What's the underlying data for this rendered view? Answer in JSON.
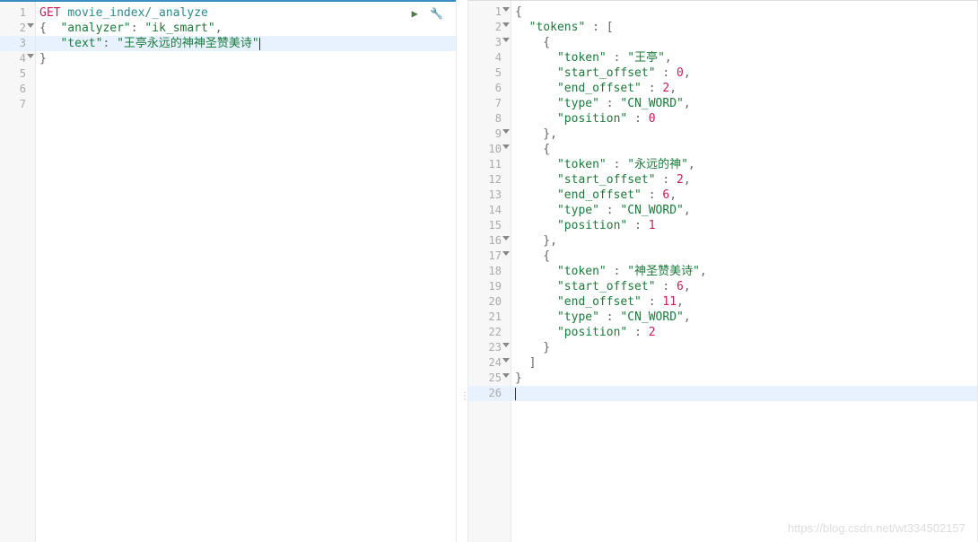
{
  "left": {
    "lines": [
      {
        "n": "1",
        "fold": false,
        "hl": false,
        "segs": [
          {
            "t": "GET ",
            "c": "method"
          },
          {
            "t": "movie_index/_analyze",
            "c": "url"
          }
        ]
      },
      {
        "n": "2",
        "fold": true,
        "hl": false,
        "segs": [
          {
            "t": "{  ",
            "c": "punct"
          },
          {
            "t": "\"analyzer\"",
            "c": "key"
          },
          {
            "t": ": ",
            "c": "punct"
          },
          {
            "t": "\"ik_smart\"",
            "c": "str"
          },
          {
            "t": ",",
            "c": "punct"
          }
        ]
      },
      {
        "n": "3",
        "fold": false,
        "hl": true,
        "segs": [
          {
            "t": "   ",
            "c": ""
          },
          {
            "t": "\"text\"",
            "c": "key"
          },
          {
            "t": ": ",
            "c": "punct"
          },
          {
            "t": "\"王亭永远的神神圣赞美诗\"",
            "c": "str"
          }
        ],
        "cursor": true
      },
      {
        "n": "4",
        "fold": true,
        "hl": false,
        "segs": [
          {
            "t": "}",
            "c": "punct"
          }
        ]
      },
      {
        "n": "5",
        "fold": false,
        "hl": false,
        "segs": []
      },
      {
        "n": "6",
        "fold": false,
        "hl": false,
        "segs": []
      },
      {
        "n": "7",
        "fold": false,
        "hl": false,
        "segs": []
      }
    ]
  },
  "right": {
    "lines": [
      {
        "n": "1",
        "fold": true,
        "hl": false,
        "segs": [
          {
            "t": "{",
            "c": "punct"
          }
        ]
      },
      {
        "n": "2",
        "fold": true,
        "hl": false,
        "segs": [
          {
            "t": "  ",
            "c": ""
          },
          {
            "t": "\"tokens\"",
            "c": "key"
          },
          {
            "t": " : [",
            "c": "punct"
          }
        ]
      },
      {
        "n": "3",
        "fold": true,
        "hl": false,
        "segs": [
          {
            "t": "    {",
            "c": "punct"
          }
        ]
      },
      {
        "n": "4",
        "fold": false,
        "hl": false,
        "segs": [
          {
            "t": "      ",
            "c": ""
          },
          {
            "t": "\"token\"",
            "c": "key"
          },
          {
            "t": " : ",
            "c": "punct"
          },
          {
            "t": "\"王亭\"",
            "c": "str"
          },
          {
            "t": ",",
            "c": "punct"
          }
        ]
      },
      {
        "n": "5",
        "fold": false,
        "hl": false,
        "segs": [
          {
            "t": "      ",
            "c": ""
          },
          {
            "t": "\"start_offset\"",
            "c": "key"
          },
          {
            "t": " : ",
            "c": "punct"
          },
          {
            "t": "0",
            "c": "num"
          },
          {
            "t": ",",
            "c": "punct"
          }
        ]
      },
      {
        "n": "6",
        "fold": false,
        "hl": false,
        "segs": [
          {
            "t": "      ",
            "c": ""
          },
          {
            "t": "\"end_offset\"",
            "c": "key"
          },
          {
            "t": " : ",
            "c": "punct"
          },
          {
            "t": "2",
            "c": "num"
          },
          {
            "t": ",",
            "c": "punct"
          }
        ]
      },
      {
        "n": "7",
        "fold": false,
        "hl": false,
        "segs": [
          {
            "t": "      ",
            "c": ""
          },
          {
            "t": "\"type\"",
            "c": "key"
          },
          {
            "t": " : ",
            "c": "punct"
          },
          {
            "t": "\"CN_WORD\"",
            "c": "str"
          },
          {
            "t": ",",
            "c": "punct"
          }
        ]
      },
      {
        "n": "8",
        "fold": false,
        "hl": false,
        "segs": [
          {
            "t": "      ",
            "c": ""
          },
          {
            "t": "\"position\"",
            "c": "key"
          },
          {
            "t": " : ",
            "c": "punct"
          },
          {
            "t": "0",
            "c": "num"
          }
        ]
      },
      {
        "n": "9",
        "fold": true,
        "hl": false,
        "segs": [
          {
            "t": "    },",
            "c": "punct"
          }
        ]
      },
      {
        "n": "10",
        "fold": true,
        "hl": false,
        "segs": [
          {
            "t": "    {",
            "c": "punct"
          }
        ]
      },
      {
        "n": "11",
        "fold": false,
        "hl": false,
        "segs": [
          {
            "t": "      ",
            "c": ""
          },
          {
            "t": "\"token\"",
            "c": "key"
          },
          {
            "t": " : ",
            "c": "punct"
          },
          {
            "t": "\"永远的神\"",
            "c": "str"
          },
          {
            "t": ",",
            "c": "punct"
          }
        ]
      },
      {
        "n": "12",
        "fold": false,
        "hl": false,
        "segs": [
          {
            "t": "      ",
            "c": ""
          },
          {
            "t": "\"start_offset\"",
            "c": "key"
          },
          {
            "t": " : ",
            "c": "punct"
          },
          {
            "t": "2",
            "c": "num"
          },
          {
            "t": ",",
            "c": "punct"
          }
        ]
      },
      {
        "n": "13",
        "fold": false,
        "hl": false,
        "segs": [
          {
            "t": "      ",
            "c": ""
          },
          {
            "t": "\"end_offset\"",
            "c": "key"
          },
          {
            "t": " : ",
            "c": "punct"
          },
          {
            "t": "6",
            "c": "num"
          },
          {
            "t": ",",
            "c": "punct"
          }
        ]
      },
      {
        "n": "14",
        "fold": false,
        "hl": false,
        "segs": [
          {
            "t": "      ",
            "c": ""
          },
          {
            "t": "\"type\"",
            "c": "key"
          },
          {
            "t": " : ",
            "c": "punct"
          },
          {
            "t": "\"CN_WORD\"",
            "c": "str"
          },
          {
            "t": ",",
            "c": "punct"
          }
        ]
      },
      {
        "n": "15",
        "fold": false,
        "hl": false,
        "segs": [
          {
            "t": "      ",
            "c": ""
          },
          {
            "t": "\"position\"",
            "c": "key"
          },
          {
            "t": " : ",
            "c": "punct"
          },
          {
            "t": "1",
            "c": "num"
          }
        ]
      },
      {
        "n": "16",
        "fold": true,
        "hl": false,
        "segs": [
          {
            "t": "    },",
            "c": "punct"
          }
        ]
      },
      {
        "n": "17",
        "fold": true,
        "hl": false,
        "segs": [
          {
            "t": "    {",
            "c": "punct"
          }
        ]
      },
      {
        "n": "18",
        "fold": false,
        "hl": false,
        "segs": [
          {
            "t": "      ",
            "c": ""
          },
          {
            "t": "\"token\"",
            "c": "key"
          },
          {
            "t": " : ",
            "c": "punct"
          },
          {
            "t": "\"神圣赞美诗\"",
            "c": "str"
          },
          {
            "t": ",",
            "c": "punct"
          }
        ]
      },
      {
        "n": "19",
        "fold": false,
        "hl": false,
        "segs": [
          {
            "t": "      ",
            "c": ""
          },
          {
            "t": "\"start_offset\"",
            "c": "key"
          },
          {
            "t": " : ",
            "c": "punct"
          },
          {
            "t": "6",
            "c": "num"
          },
          {
            "t": ",",
            "c": "punct"
          }
        ]
      },
      {
        "n": "20",
        "fold": false,
        "hl": false,
        "segs": [
          {
            "t": "      ",
            "c": ""
          },
          {
            "t": "\"end_offset\"",
            "c": "key"
          },
          {
            "t": " : ",
            "c": "punct"
          },
          {
            "t": "11",
            "c": "num"
          },
          {
            "t": ",",
            "c": "punct"
          }
        ]
      },
      {
        "n": "21",
        "fold": false,
        "hl": false,
        "segs": [
          {
            "t": "      ",
            "c": ""
          },
          {
            "t": "\"type\"",
            "c": "key"
          },
          {
            "t": " : ",
            "c": "punct"
          },
          {
            "t": "\"CN_WORD\"",
            "c": "str"
          },
          {
            "t": ",",
            "c": "punct"
          }
        ]
      },
      {
        "n": "22",
        "fold": false,
        "hl": false,
        "segs": [
          {
            "t": "      ",
            "c": ""
          },
          {
            "t": "\"position\"",
            "c": "key"
          },
          {
            "t": " : ",
            "c": "punct"
          },
          {
            "t": "2",
            "c": "num"
          }
        ]
      },
      {
        "n": "23",
        "fold": true,
        "hl": false,
        "segs": [
          {
            "t": "    }",
            "c": "punct"
          }
        ]
      },
      {
        "n": "24",
        "fold": true,
        "hl": false,
        "segs": [
          {
            "t": "  ]",
            "c": "punct"
          }
        ]
      },
      {
        "n": "25",
        "fold": true,
        "hl": false,
        "segs": [
          {
            "t": "}",
            "c": "punct"
          }
        ]
      },
      {
        "n": "26",
        "fold": false,
        "hl": true,
        "segs": [],
        "cursor": true
      }
    ]
  },
  "toolbar": {
    "run": "▶",
    "wrench": "🔧"
  },
  "watermark": "https://blog.csdn.net/wt334502157"
}
